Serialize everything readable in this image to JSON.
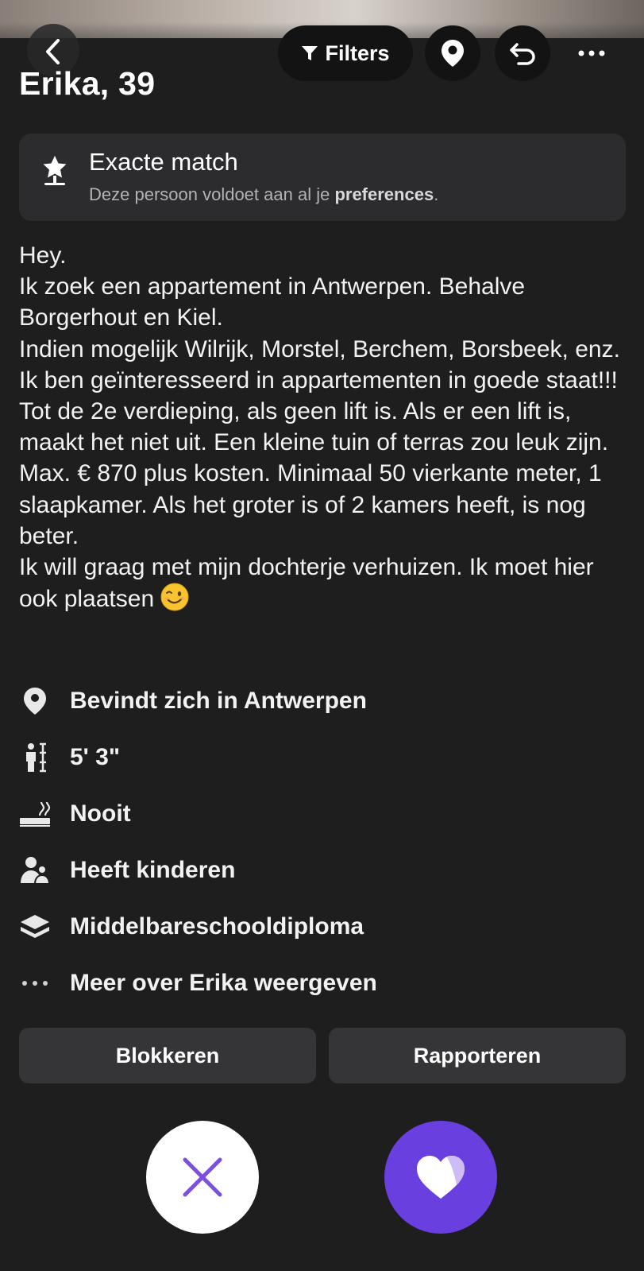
{
  "header": {
    "filters_label": "Filters",
    "icons": {
      "back": "chevron-left-icon",
      "filter": "filter-icon",
      "location": "location-pin-icon",
      "undo": "undo-icon",
      "more": "more-horizontal-icon"
    }
  },
  "profile": {
    "name_age": "Erika, 39"
  },
  "match_card": {
    "title": "Exacte match",
    "subtitle_prefix": "Deze persoon voldoet aan al je ",
    "subtitle_bold": "preferences",
    "subtitle_suffix": ".",
    "icon": "star-badge-icon"
  },
  "bio": {
    "text": "Hey.\nIk zoek een appartement in Antwerpen. Behalve Borgerhout en Kiel.\nIndien mogelijk Wilrijk, Morstel, Berchem, Borsbeek, enz.\nIk ben geïnteresseerd in appartementen in goede staat!!! Tot de 2e verdieping, als geen lift is. Als er een lift is, maakt het niet uit. Een kleine tuin of terras zou leuk zijn. Max. € 870 plus kosten. Minimaal 50 vierkante meter, 1 slaapkamer. Als het groter is of 2 kamers heeft, is nog beter.\nIk will graag met mijn dochterje verhuizen. Ik moet hier ook plaatsen",
    "emoji": "winking-face"
  },
  "details": [
    {
      "icon": "location-pin-icon",
      "text": "Bevindt zich in Antwerpen"
    },
    {
      "icon": "height-icon",
      "text": "5' 3\""
    },
    {
      "icon": "smoking-icon",
      "text": "Nooit"
    },
    {
      "icon": "children-icon",
      "text": "Heeft kinderen"
    },
    {
      "icon": "education-icon",
      "text": "Middelbareschooldiploma"
    },
    {
      "icon": "more-horizontal-icon",
      "text": "Meer over Erika weergeven"
    }
  ],
  "actions": {
    "block_label": "Blokkeren",
    "report_label": "Rapporteren"
  },
  "bottom_buttons": {
    "pass_icon": "close-icon",
    "like_icon": "heart-icon"
  },
  "colors": {
    "background": "#1e1e1f",
    "card": "#2c2c2e",
    "button": "#353537",
    "accent_purple": "#6a3fe0",
    "pass_x": "#7b4fe0"
  }
}
